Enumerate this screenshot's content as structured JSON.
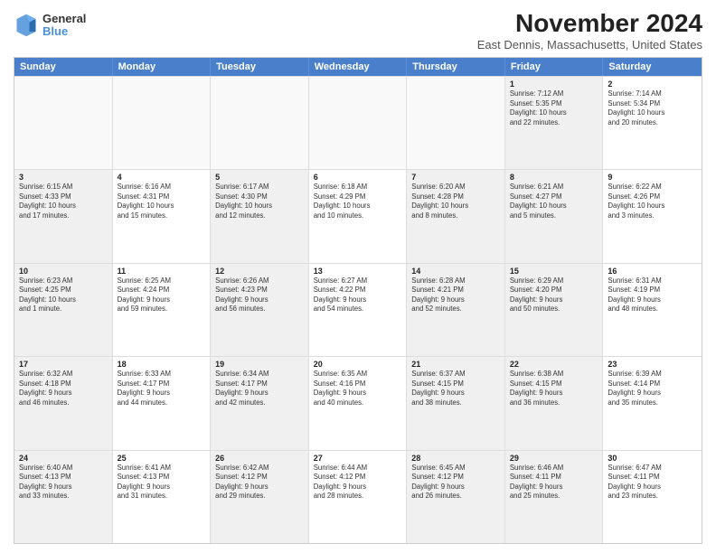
{
  "logo": {
    "general": "General",
    "blue": "Blue"
  },
  "title": "November 2024",
  "subtitle": "East Dennis, Massachusetts, United States",
  "header": {
    "days": [
      "Sunday",
      "Monday",
      "Tuesday",
      "Wednesday",
      "Thursday",
      "Friday",
      "Saturday"
    ]
  },
  "rows": [
    {
      "cells": [
        {
          "day": "",
          "info": "",
          "empty": true
        },
        {
          "day": "",
          "info": "",
          "empty": true
        },
        {
          "day": "",
          "info": "",
          "empty": true
        },
        {
          "day": "",
          "info": "",
          "empty": true
        },
        {
          "day": "",
          "info": "",
          "empty": true
        },
        {
          "day": "1",
          "info": "Sunrise: 7:12 AM\nSunset: 5:35 PM\nDaylight: 10 hours\nand 22 minutes.",
          "shaded": true
        },
        {
          "day": "2",
          "info": "Sunrise: 7:14 AM\nSunset: 5:34 PM\nDaylight: 10 hours\nand 20 minutes.",
          "shaded": false
        }
      ]
    },
    {
      "cells": [
        {
          "day": "3",
          "info": "Sunrise: 6:15 AM\nSunset: 4:33 PM\nDaylight: 10 hours\nand 17 minutes.",
          "shaded": true
        },
        {
          "day": "4",
          "info": "Sunrise: 6:16 AM\nSunset: 4:31 PM\nDaylight: 10 hours\nand 15 minutes.",
          "shaded": false
        },
        {
          "day": "5",
          "info": "Sunrise: 6:17 AM\nSunset: 4:30 PM\nDaylight: 10 hours\nand 12 minutes.",
          "shaded": true
        },
        {
          "day": "6",
          "info": "Sunrise: 6:18 AM\nSunset: 4:29 PM\nDaylight: 10 hours\nand 10 minutes.",
          "shaded": false
        },
        {
          "day": "7",
          "info": "Sunrise: 6:20 AM\nSunset: 4:28 PM\nDaylight: 10 hours\nand 8 minutes.",
          "shaded": true
        },
        {
          "day": "8",
          "info": "Sunrise: 6:21 AM\nSunset: 4:27 PM\nDaylight: 10 hours\nand 5 minutes.",
          "shaded": true
        },
        {
          "day": "9",
          "info": "Sunrise: 6:22 AM\nSunset: 4:26 PM\nDaylight: 10 hours\nand 3 minutes.",
          "shaded": false
        }
      ]
    },
    {
      "cells": [
        {
          "day": "10",
          "info": "Sunrise: 6:23 AM\nSunset: 4:25 PM\nDaylight: 10 hours\nand 1 minute.",
          "shaded": true
        },
        {
          "day": "11",
          "info": "Sunrise: 6:25 AM\nSunset: 4:24 PM\nDaylight: 9 hours\nand 59 minutes.",
          "shaded": false
        },
        {
          "day": "12",
          "info": "Sunrise: 6:26 AM\nSunset: 4:23 PM\nDaylight: 9 hours\nand 56 minutes.",
          "shaded": true
        },
        {
          "day": "13",
          "info": "Sunrise: 6:27 AM\nSunset: 4:22 PM\nDaylight: 9 hours\nand 54 minutes.",
          "shaded": false
        },
        {
          "day": "14",
          "info": "Sunrise: 6:28 AM\nSunset: 4:21 PM\nDaylight: 9 hours\nand 52 minutes.",
          "shaded": true
        },
        {
          "day": "15",
          "info": "Sunrise: 6:29 AM\nSunset: 4:20 PM\nDaylight: 9 hours\nand 50 minutes.",
          "shaded": true
        },
        {
          "day": "16",
          "info": "Sunrise: 6:31 AM\nSunset: 4:19 PM\nDaylight: 9 hours\nand 48 minutes.",
          "shaded": false
        }
      ]
    },
    {
      "cells": [
        {
          "day": "17",
          "info": "Sunrise: 6:32 AM\nSunset: 4:18 PM\nDaylight: 9 hours\nand 46 minutes.",
          "shaded": true
        },
        {
          "day": "18",
          "info": "Sunrise: 6:33 AM\nSunset: 4:17 PM\nDaylight: 9 hours\nand 44 minutes.",
          "shaded": false
        },
        {
          "day": "19",
          "info": "Sunrise: 6:34 AM\nSunset: 4:17 PM\nDaylight: 9 hours\nand 42 minutes.",
          "shaded": true
        },
        {
          "day": "20",
          "info": "Sunrise: 6:35 AM\nSunset: 4:16 PM\nDaylight: 9 hours\nand 40 minutes.",
          "shaded": false
        },
        {
          "day": "21",
          "info": "Sunrise: 6:37 AM\nSunset: 4:15 PM\nDaylight: 9 hours\nand 38 minutes.",
          "shaded": true
        },
        {
          "day": "22",
          "info": "Sunrise: 6:38 AM\nSunset: 4:15 PM\nDaylight: 9 hours\nand 36 minutes.",
          "shaded": true
        },
        {
          "day": "23",
          "info": "Sunrise: 6:39 AM\nSunset: 4:14 PM\nDaylight: 9 hours\nand 35 minutes.",
          "shaded": false
        }
      ]
    },
    {
      "cells": [
        {
          "day": "24",
          "info": "Sunrise: 6:40 AM\nSunset: 4:13 PM\nDaylight: 9 hours\nand 33 minutes.",
          "shaded": true
        },
        {
          "day": "25",
          "info": "Sunrise: 6:41 AM\nSunset: 4:13 PM\nDaylight: 9 hours\nand 31 minutes.",
          "shaded": false
        },
        {
          "day": "26",
          "info": "Sunrise: 6:42 AM\nSunset: 4:12 PM\nDaylight: 9 hours\nand 29 minutes.",
          "shaded": true
        },
        {
          "day": "27",
          "info": "Sunrise: 6:44 AM\nSunset: 4:12 PM\nDaylight: 9 hours\nand 28 minutes.",
          "shaded": false
        },
        {
          "day": "28",
          "info": "Sunrise: 6:45 AM\nSunset: 4:12 PM\nDaylight: 9 hours\nand 26 minutes.",
          "shaded": true
        },
        {
          "day": "29",
          "info": "Sunrise: 6:46 AM\nSunset: 4:11 PM\nDaylight: 9 hours\nand 25 minutes.",
          "shaded": true
        },
        {
          "day": "30",
          "info": "Sunrise: 6:47 AM\nSunset: 4:11 PM\nDaylight: 9 hours\nand 23 minutes.",
          "shaded": false
        }
      ]
    }
  ]
}
